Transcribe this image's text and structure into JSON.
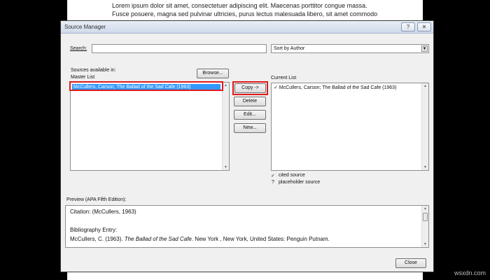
{
  "document": {
    "line1": "Lorem ipsum dolor sit amet, consectetuer adipiscing elit. Maecenas porttitor congue massa.",
    "line2": "Fusce posuere, magna sed pulvinar ultricies, purus lectus malesuada  libero, sit amet commodo"
  },
  "dialog": {
    "title": "Source Manager",
    "help_label": "?",
    "close_label": "✕",
    "search": {
      "label": "Search:",
      "value": ""
    },
    "sort": {
      "value": "Sort by Author"
    },
    "sources_label": "Sources available in:",
    "master_list_label": "Master List",
    "browse_label": "Browse...",
    "master_list_items": [
      "McCullers, Carson; The Ballad of the Sad Cafe (1963)"
    ],
    "actions": {
      "copy": "Copy ->",
      "delete": "Delete",
      "edit": "Edit...",
      "new": "New..."
    },
    "current_list_label": "Current List",
    "current_list_items": [
      {
        "check": "✓",
        "text": "McCullers, Carson; The Ballad of the Sad Cafe (1963)"
      }
    ],
    "legend": {
      "cited_mark": "✓",
      "cited_text": "cited source",
      "placeholder_mark": "?",
      "placeholder_text": "placeholder source"
    },
    "preview": {
      "label": "Preview (APA Fifth Edition):",
      "citation": "Citation: (McCullers, 1963)",
      "bibliography_label": "Bibliography Entry:",
      "entry_author": "McCullers, C. (1963). ",
      "entry_title": "The Ballad of the Sad Cafe",
      "entry_rest": ". New York , New York, United States: Penguin Putnam."
    },
    "close_button": "Close"
  },
  "watermark": "wsxdn.com"
}
